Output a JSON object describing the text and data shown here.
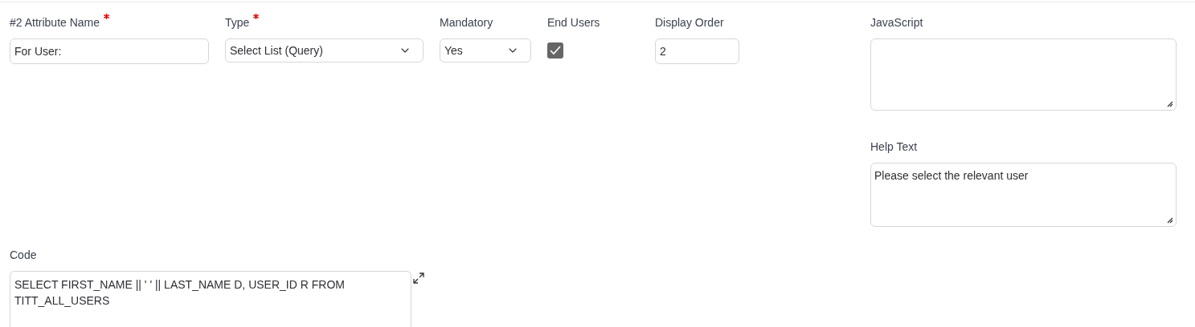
{
  "attribute_name": {
    "label": "#2 Attribute Name",
    "required": true,
    "value": "For User:"
  },
  "type": {
    "label": "Type",
    "required": true,
    "value": "Select List (Query)"
  },
  "mandatory": {
    "label": "Mandatory",
    "value": "Yes"
  },
  "end_users": {
    "label": "End Users",
    "checked": true
  },
  "display_order": {
    "label": "Display Order",
    "value": "2"
  },
  "javascript": {
    "label": "JavaScript"
  },
  "help_text": {
    "label": "Help Text",
    "value": "Please select the relevant user"
  },
  "code": {
    "label": "Code",
    "value": "SELECT FIRST_NAME || ' ' || LAST_NAME D, USER_ID R FROM TITT_ALL_USERS"
  }
}
